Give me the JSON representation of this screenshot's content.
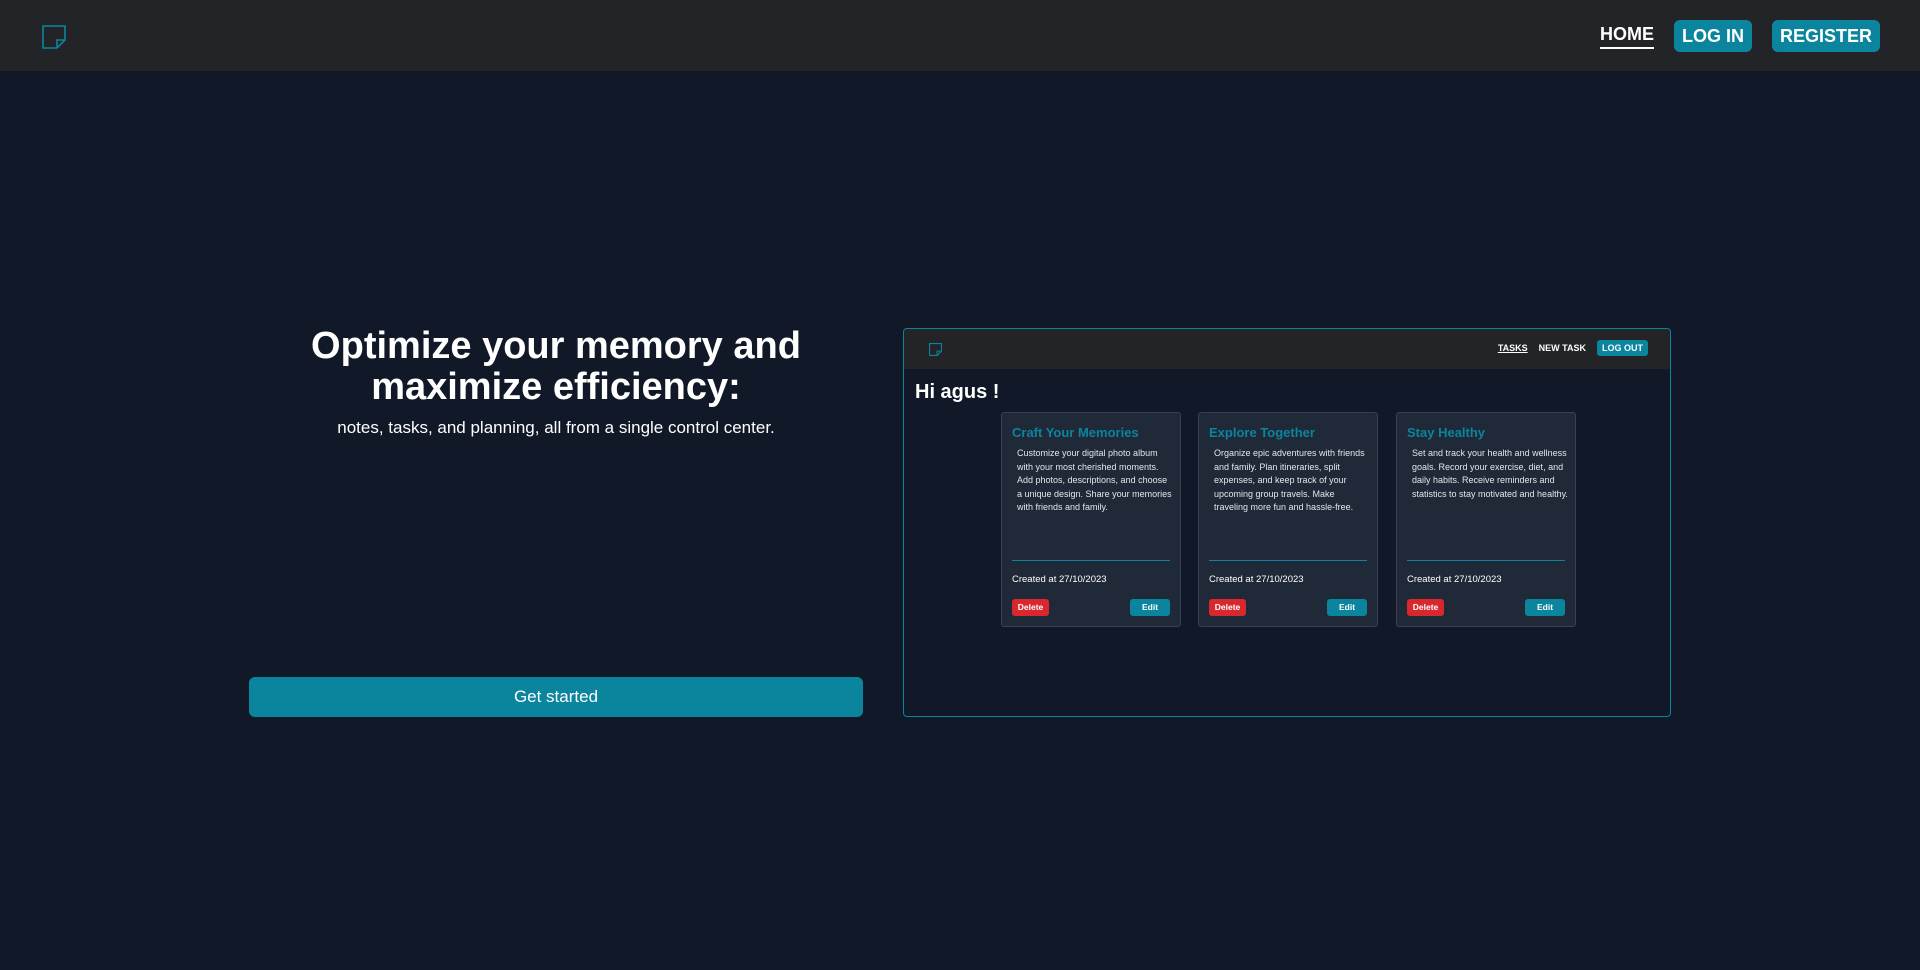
{
  "nav": {
    "logo_icon": "sticky-note-icon",
    "home": "HOME",
    "login": "LOG IN",
    "register": "REGISTER"
  },
  "hero": {
    "title": "Optimize your memory and maximize efficiency:",
    "subtitle": "notes, tasks, and planning, all from a single control center.",
    "cta": "Get started"
  },
  "preview": {
    "nav": {
      "logo_icon": "sticky-note-icon",
      "tasks": "TASKS",
      "new_task": "NEW TASK",
      "logout": "LOG OUT"
    },
    "greeting": "Hi agus !",
    "cards": [
      {
        "title": "Craft Your Memories",
        "description": "Customize your digital photo album with your most cherished moments. Add photos, descriptions, and choose a unique design. Share your memories with friends and family.",
        "created": "Created at 27/10/2023",
        "delete": "Delete",
        "edit": "Edit"
      },
      {
        "title": "Explore Together",
        "description": "Organize epic adventures with friends and family. Plan itineraries, split expenses, and keep track of your upcoming group travels. Make traveling more fun and hassle-free.",
        "created": "Created at 27/10/2023",
        "delete": "Delete",
        "edit": "Edit"
      },
      {
        "title": "Stay Healthy",
        "description": "Set and track your health and wellness goals. Record your exercise, diet, and daily habits. Receive reminders and statistics to stay motivated and healthy.",
        "created": "Created at 27/10/2023",
        "delete": "Delete",
        "edit": "Edit"
      }
    ]
  },
  "colors": {
    "background": "#111827",
    "navbar": "#232427",
    "accent": "#0b849e",
    "danger": "#d9272e"
  }
}
